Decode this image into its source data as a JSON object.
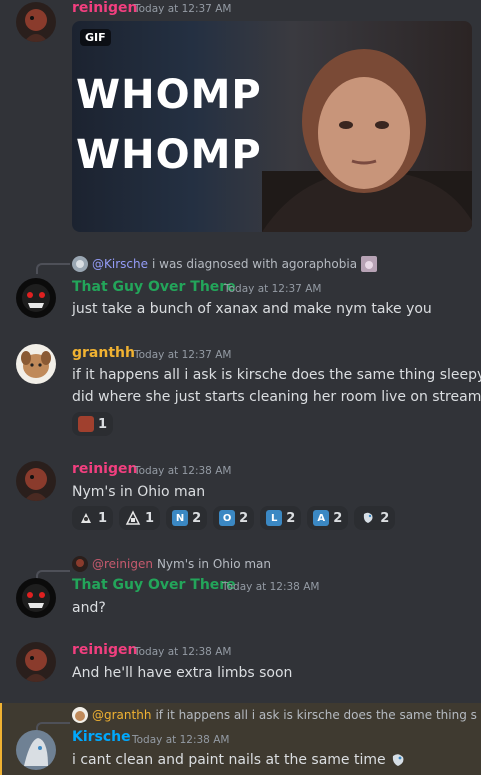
{
  "messages": [
    {
      "author": "reinigen",
      "author_color": "#f23f7f",
      "time": "Today at 12:37 AM",
      "gif": {
        "badge": "GIF",
        "line1": "WHOMP",
        "line2": "WHOMP"
      }
    },
    {
      "reply": {
        "mention": "@Kirsche",
        "text": "i was diagnosed with agoraphobia"
      },
      "author": "That Guy Over There",
      "author_color": "#23a55a",
      "time": "Today at 12:37 AM",
      "text": "just take a bunch of xanax and make nym take you"
    },
    {
      "author": "granthh",
      "author_color": "#f0b232",
      "time": "Today at 12:37 AM",
      "text_line1": "if it happens all i ask is kirsche does the same thing sleepy",
      "text_line2": "did where she just starts cleaning her room live on stream",
      "reactions": [
        {
          "icon": "face-emoji-icon",
          "count": "1"
        }
      ]
    },
    {
      "author": "reinigen",
      "author_color": "#f23f7f",
      "time": "Today at 12:38 AM",
      "text": "Nym's in Ohio man",
      "reactions": [
        {
          "icon": "custom-emoji-icon",
          "count": "1"
        },
        {
          "icon": "custom-emoji-icon",
          "count": "1"
        },
        {
          "icon": "regional-n-icon",
          "letter": "N",
          "count": "2"
        },
        {
          "icon": "regional-o-icon",
          "letter": "O",
          "count": "2"
        },
        {
          "icon": "regional-l-icon",
          "letter": "L",
          "count": "2"
        },
        {
          "icon": "regional-a-icon",
          "letter": "A",
          "count": "2"
        },
        {
          "icon": "custom-emoji-icon",
          "count": "2"
        }
      ]
    },
    {
      "reply": {
        "mention": "@reinigen",
        "text": "Nym's in Ohio man"
      },
      "author": "That Guy Over There",
      "author_color": "#23a55a",
      "time": "Today at 12:38 AM",
      "text": "and?"
    },
    {
      "author": "reinigen",
      "author_color": "#f23f7f",
      "time": "Today at 12:38 AM",
      "text": "And he'll have extra limbs soon"
    },
    {
      "reply": {
        "mention": "@granthh",
        "text": "if it happens all i ask is kirsche does the same thing sle"
      },
      "author": "Kirsche",
      "author_color": "#00a8fc",
      "time": "Today at 12:38 AM",
      "text": "i cant clean and paint nails at the same time"
    }
  ],
  "colors": {
    "background": "#313338",
    "mention": "#949cf7",
    "regional": "#3b88c3"
  }
}
